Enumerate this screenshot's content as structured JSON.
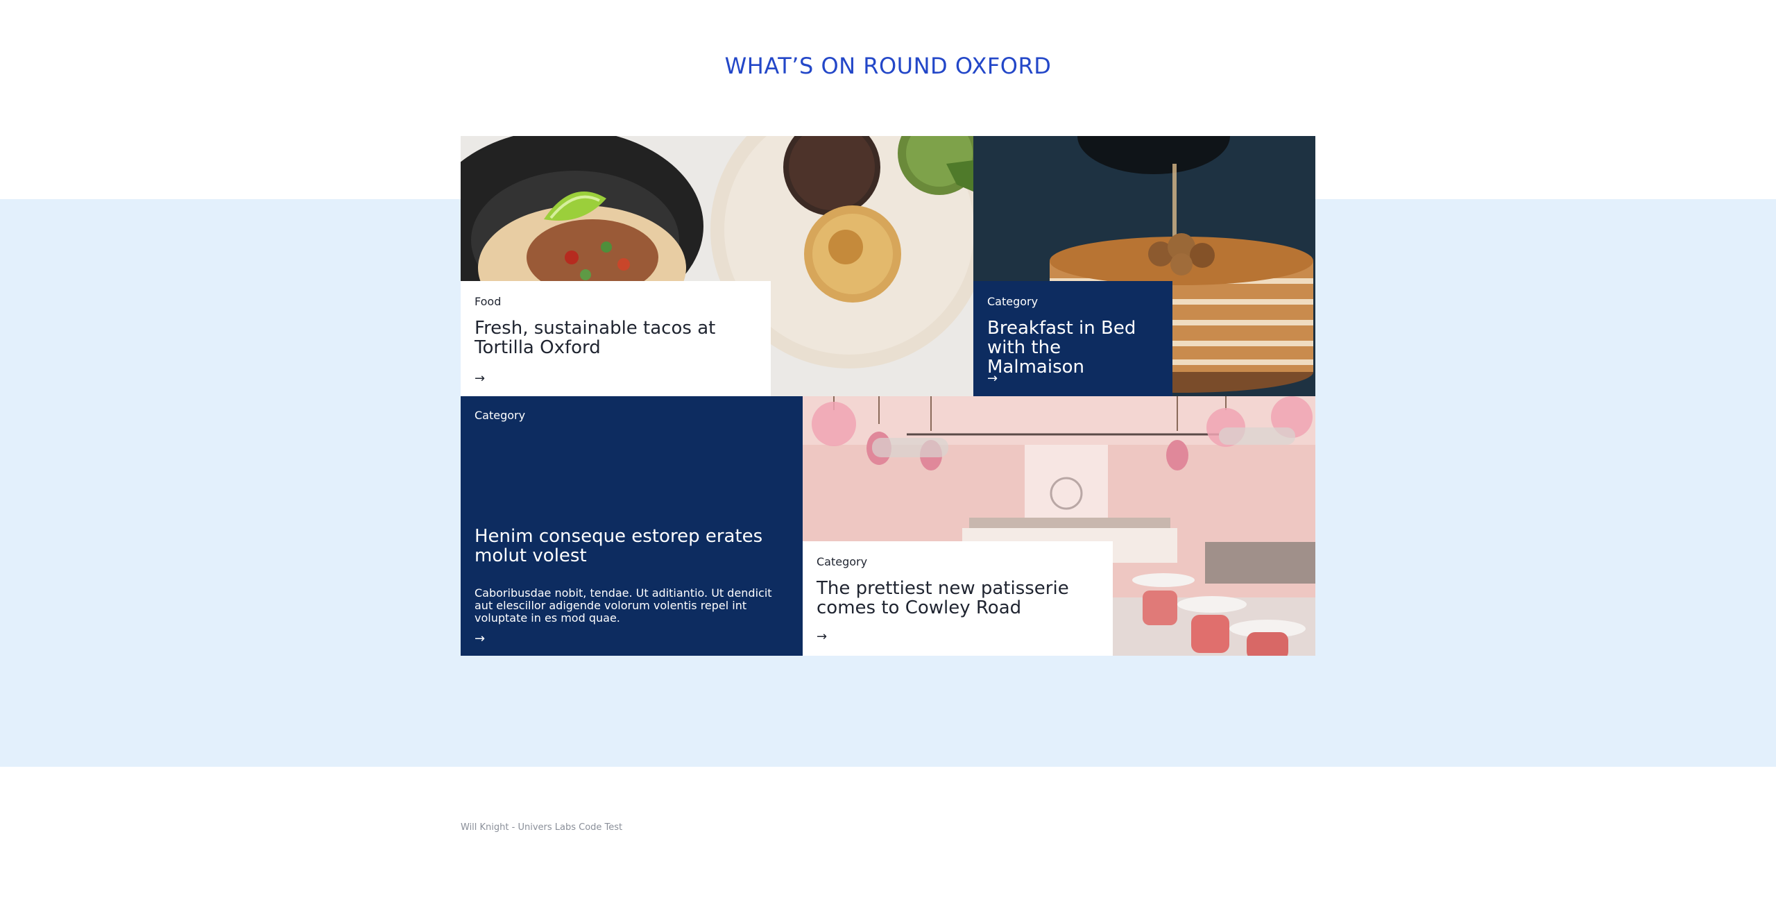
{
  "section_title": "WHAT’S ON ROUND OXFORD",
  "colors": {
    "title_blue": "#2347c8",
    "navy": "#0d2c60",
    "band": "#e3f0fc"
  },
  "cards": [
    {
      "category": "Food",
      "headline": "Fresh, sustainable tacos at Tortilla Oxford",
      "arrow": "→",
      "image": "tacos-and-arepas-photo"
    },
    {
      "category": "Category",
      "headline": "Breakfast in Bed with the Malmaison",
      "arrow": "→",
      "image": "pancakes-syrup-photo"
    },
    {
      "category": "Category",
      "headline": "Henim conseque estorep erates molut volest",
      "description": "Caboribusdae nobit, tendae. Ut aditiantio. Ut dendicit aut elescillor adigende volorum volentis repel int voluptate in es mod quae.",
      "arrow": "→"
    },
    {
      "category": "Category",
      "headline": "The prettiest new patisserie comes to Cowley Road",
      "arrow": "→",
      "image": "pink-patisserie-interior-photo"
    }
  ],
  "footer": "Will Knight - Univers Labs Code Test"
}
